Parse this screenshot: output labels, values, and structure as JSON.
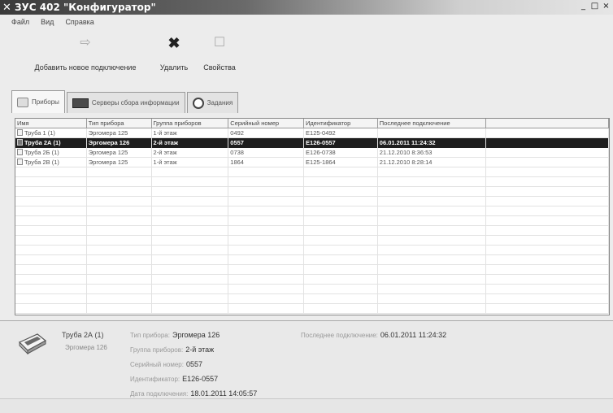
{
  "window": {
    "title": "ЗУС 402 \"Конфигуратор\"",
    "controls": [
      "_",
      "□",
      "×"
    ]
  },
  "menu": [
    "Файл",
    "Вид",
    "Справка"
  ],
  "toolbar": {
    "add_label": "Добавить новое подключение",
    "delete_label": "Удалить",
    "properties_label": "Свойства"
  },
  "tabs": [
    {
      "label": "Приборы",
      "icon": "device-icon"
    },
    {
      "label": "Серверы сбора информации",
      "icon": "server-icon"
    },
    {
      "label": "Задания",
      "icon": "clock-icon"
    }
  ],
  "table": {
    "columns": [
      "Имя",
      "Тип прибора",
      "Группа приборов",
      "Серийный номер",
      "Идентификатор",
      "Последнее подключение"
    ],
    "rows": [
      {
        "name": "Труба 1 (1)",
        "type": "Эргомера 125",
        "group": "1-й этаж",
        "serial": "0492",
        "id": "E125-0492",
        "last": "",
        "selected": false
      },
      {
        "name": "Труба 2А (1)",
        "type": "Эргомера 126",
        "group": "2-й этаж",
        "serial": "0557",
        "id": "E126-0557",
        "last": "06.01.2011 11:24:32",
        "selected": true
      },
      {
        "name": "Труба 2Б (1)",
        "type": "Эргомера 125",
        "group": "2-й этаж",
        "serial": "0738",
        "id": "E126-0738",
        "last": "21.12.2010 8:36:53",
        "selected": false
      },
      {
        "name": "Труба 2В (1)",
        "type": "Эргомера 125",
        "group": "1-й этаж",
        "serial": "1864",
        "id": "E125-1864",
        "last": "21.12.2010 8:28:14",
        "selected": false
      }
    ]
  },
  "details": {
    "name": "Труба 2А (1)",
    "type_sub": "Эргомера 126",
    "fields": [
      {
        "label": "Тип прибора:",
        "value": "Эргомера 126"
      },
      {
        "label": "Группа приборов:",
        "value": "2-й этаж"
      },
      {
        "label": "Серийный номер:",
        "value": "0557"
      },
      {
        "label": "Идентификатор:",
        "value": "E126-0557"
      },
      {
        "label": "Дата подключения:",
        "value": "18.01.2011 14:05:57"
      }
    ],
    "last_label": "Последнее подключение:",
    "last_value": "06.01.2011 11:24:32"
  }
}
